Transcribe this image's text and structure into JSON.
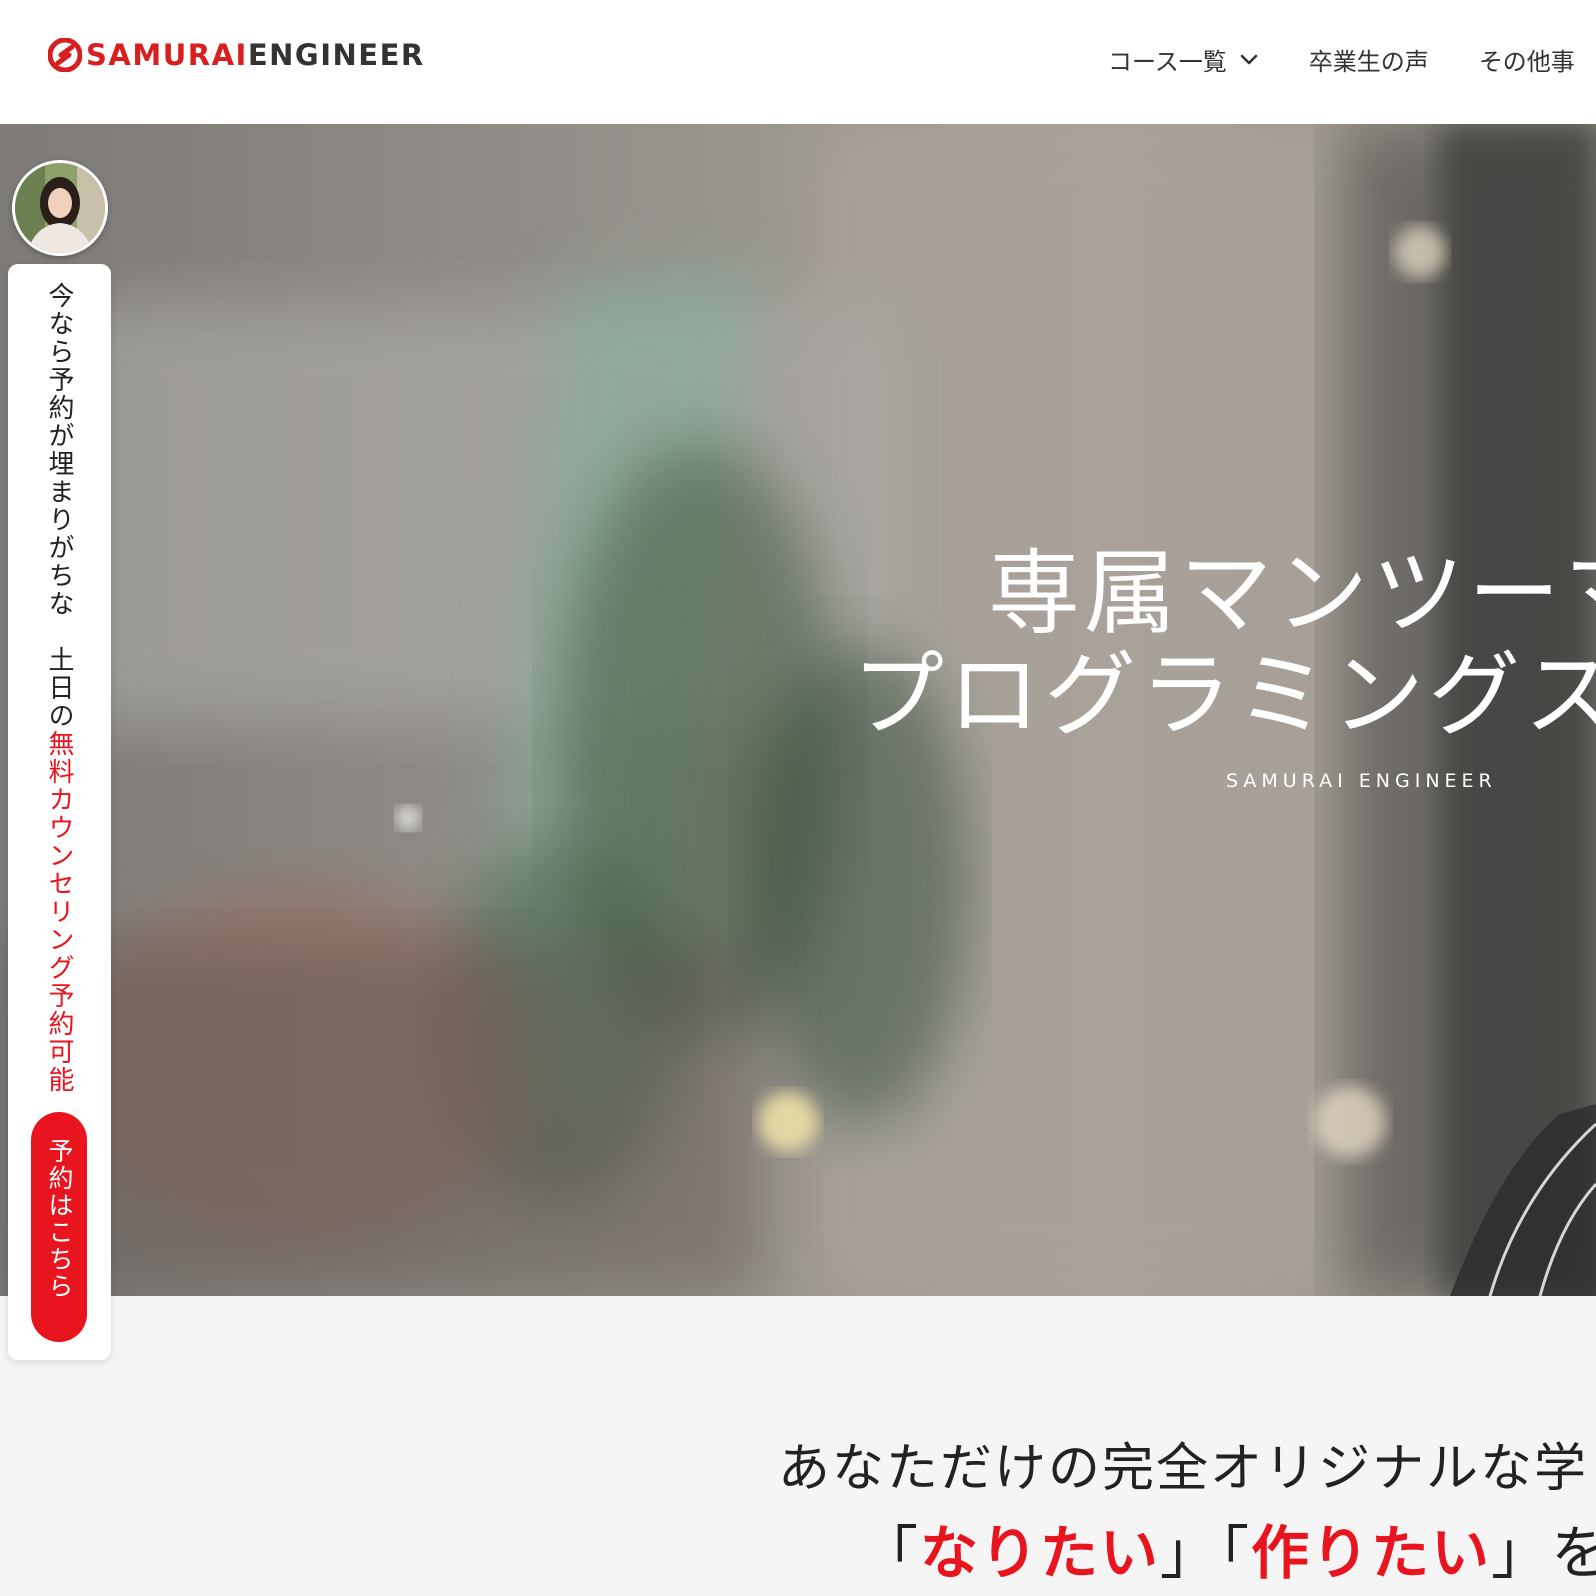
{
  "brand": {
    "logo_part1": "SAMURAI",
    "logo_part2": "ENGINEER",
    "accent_color": "#d81e1e",
    "cta_color": "#e8141e"
  },
  "nav": {
    "items": [
      {
        "label": "コース一覧",
        "icon": "chevron-down-icon"
      },
      {
        "label": "卒業生の声"
      },
      {
        "label": "その他事"
      }
    ]
  },
  "hero": {
    "line1": "専属マンツーマ",
    "line2": "プログラミングス",
    "sub": "SAMURAI ENGINEER"
  },
  "lead": {
    "line1": "あなただけの完全オリジナルな学",
    "q_open1": "「",
    "accent1": "なりたい",
    "q_close1": "」",
    "q_open2": "「",
    "accent2": "作りたい",
    "q_close2": "」",
    "tail": "を"
  },
  "side_cta": {
    "text_part1": "今なら予約が埋まりがちな　土日の",
    "text_part2": "無料カウンセリング予約可能",
    "button_label": "予約はこちら"
  }
}
